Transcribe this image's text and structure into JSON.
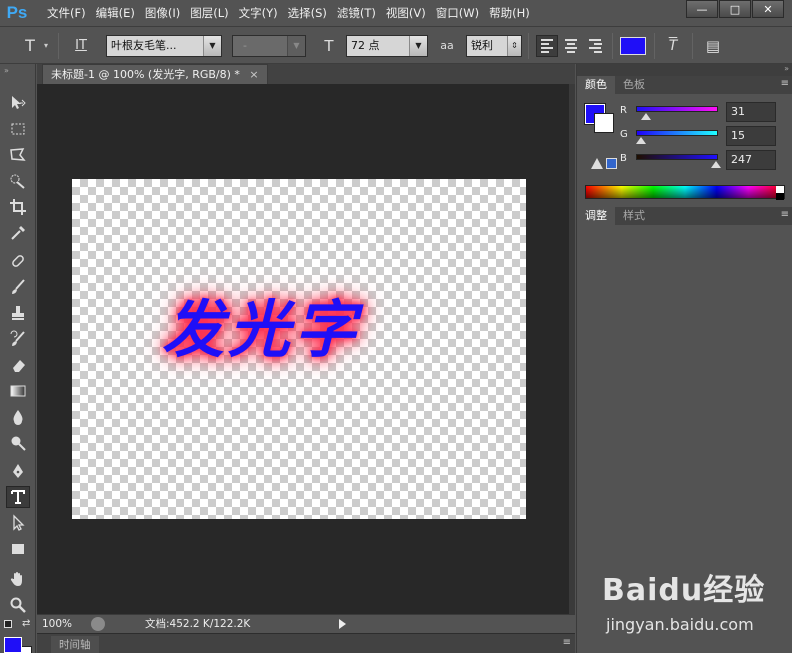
{
  "app": {
    "logo": "Ps",
    "menu": [
      "文件(F)",
      "编辑(E)",
      "图像(I)",
      "图层(L)",
      "文字(Y)",
      "选择(S)",
      "滤镜(T)",
      "视图(V)",
      "窗口(W)",
      "帮助(H)"
    ],
    "window_controls": {
      "minimize": "—",
      "maximize": "□",
      "close": "✕"
    }
  },
  "options": {
    "tool_icon": "T",
    "orient_icon": "IT",
    "font_family": "叶根友毛笔...",
    "font_style": "-",
    "size_icon": "T",
    "font_size": "72 点",
    "aa_icon": "aa",
    "antialias": "锐利",
    "text_color": "#1f0ff7",
    "warp_icon": "T",
    "panel_icon": "▤"
  },
  "document": {
    "tab_title": "未标题-1 @ 100% (发光字, RGB/8) *",
    "tab_close": "×",
    "canvas_text": "发光字",
    "text_color": "#1f0ff7",
    "glow_color": "#ff3355"
  },
  "status": {
    "zoom": "100%",
    "doc_info": "文档:452.2 K/122.2K"
  },
  "timeline": {
    "tab": "时间轴"
  },
  "color_panel": {
    "tabs": [
      "颜色",
      "色板"
    ],
    "fg_color": "#1f0ff7",
    "bg_color": "#ffffff",
    "channels": [
      {
        "label": "R",
        "value": "31",
        "level": 0.12
      },
      {
        "label": "G",
        "value": "15",
        "level": 0.06
      },
      {
        "label": "B",
        "value": "247",
        "level": 0.97
      }
    ]
  },
  "adjust_panel": {
    "tabs": [
      "调整",
      "样式"
    ]
  },
  "watermark": {
    "logo": "Baidu经验",
    "url": "jingyan.baidu.com"
  }
}
